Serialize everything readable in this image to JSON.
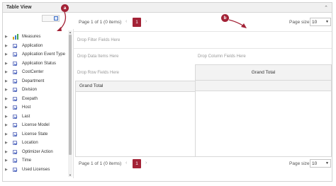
{
  "window": {
    "title": "Table View",
    "collapse_glyph": "⌃"
  },
  "callouts": {
    "a": "a",
    "b": "b"
  },
  "tree": {
    "items": [
      {
        "label": "Measures",
        "icon": "measures-icon"
      },
      {
        "label": "Application",
        "icon": "dimension-icon"
      },
      {
        "label": "Application Event Type",
        "icon": "dimension-icon"
      },
      {
        "label": "Application Status",
        "icon": "dimension-icon"
      },
      {
        "label": "CostCenter",
        "icon": "dimension-icon"
      },
      {
        "label": "Department",
        "icon": "dimension-icon"
      },
      {
        "label": "Division",
        "icon": "dimension-icon"
      },
      {
        "label": "Exepath",
        "icon": "dimension-icon"
      },
      {
        "label": "Host",
        "icon": "dimension-icon"
      },
      {
        "label": "Last",
        "icon": "dimension-icon"
      },
      {
        "label": "License Model",
        "icon": "dimension-icon"
      },
      {
        "label": "License State",
        "icon": "dimension-icon"
      },
      {
        "label": "Location",
        "icon": "dimension-icon"
      },
      {
        "label": "Optimizer Action",
        "icon": "dimension-icon"
      },
      {
        "label": "Time",
        "icon": "dimension-icon"
      },
      {
        "label": "Used Licenses",
        "icon": "dimension-icon"
      }
    ]
  },
  "pager_top": {
    "info": "Page 1 of 1 (0 items)",
    "prev": "‹",
    "page": "1",
    "next": "›",
    "pagesize_label": "Page size:",
    "pagesize_value": "10",
    "caret": "▼"
  },
  "pager_bottom": {
    "info": "Page 1 of 1 (0 items)",
    "prev": "‹",
    "page": "1",
    "next": "›",
    "pagesize_label": "Page size:",
    "pagesize_value": "10",
    "caret": "▼"
  },
  "zones": {
    "filter": "Drop Filter Fields Here",
    "data": "Drop Data Items Here",
    "column": "Drop Column Fields Here",
    "row": "Drop Row Fields Here"
  },
  "grid": {
    "grand_total_col": "Grand Total",
    "grand_total_row": "Grand Total"
  },
  "colors": {
    "accent": "#a32236"
  }
}
